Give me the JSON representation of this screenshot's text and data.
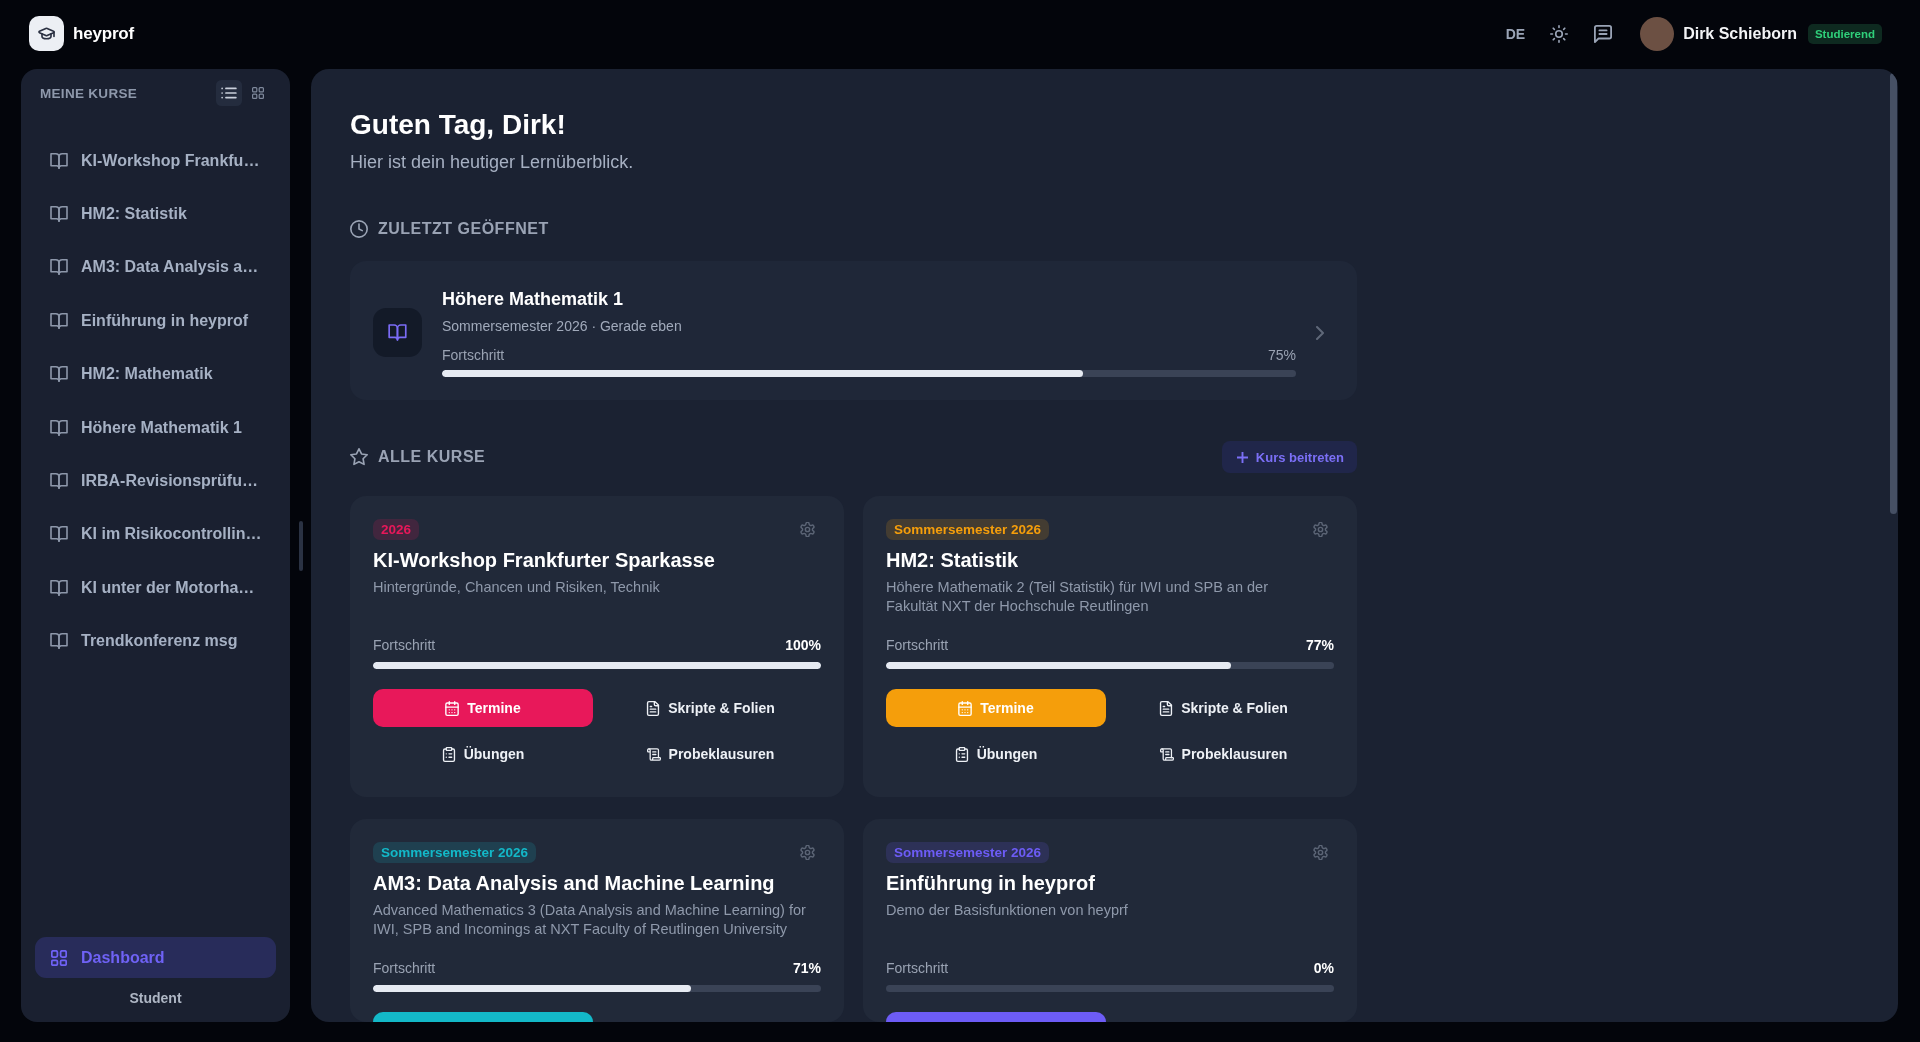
{
  "topbar": {
    "brand": "heyprof",
    "language": "DE",
    "user": {
      "name": "Dirk Schieborn",
      "role": "Studierend"
    }
  },
  "sidebar": {
    "title": "MEINE KURSE",
    "view_toggle": [
      {
        "kind": "list",
        "selected": true
      },
      {
        "kind": "grid",
        "selected": false
      }
    ],
    "items": [
      {
        "label": "KI-Workshop Frankfu…",
        "selected": false
      },
      {
        "label": "HM2: Statistik",
        "selected": false
      },
      {
        "label": "AM3: Data Analysis a…",
        "selected": false
      },
      {
        "label": "Einführung in heyprof",
        "selected": false
      },
      {
        "label": "HM2: Mathematik",
        "selected": false
      },
      {
        "label": "Höhere Mathematik 1",
        "selected": false
      },
      {
        "label": "IRBA-Revisionsprüfu…",
        "selected": false
      },
      {
        "label": "KI im Risikocontrollin…",
        "selected": false
      },
      {
        "label": "KI unter der Motorha…",
        "selected": false
      },
      {
        "label": "Trendkonferenz msg",
        "selected": false
      }
    ],
    "nav": [
      {
        "label": "Dashboard",
        "selected": true
      }
    ],
    "role_label": "Student"
  },
  "main": {
    "greeting": "Guten Tag, Dirk!",
    "subtitle": "Hier ist dein heutiger Lernüberblick.",
    "recent": {
      "heading": "ZULETZT GEÖFFNET",
      "course": {
        "title": "Höhere Mathematik 1",
        "meta": "Sommersemester 2026 · Gerade eben",
        "progress_label": "Fortschritt",
        "percent": "75%",
        "level": 0.75
      }
    },
    "all_courses": {
      "heading": "ALLE KURSE",
      "join_button": "Kurs beitreten",
      "courses": [
        {
          "tag": "2026",
          "color": "#e8185a",
          "title": "KI-Workshop Frankfurter Sparkasse",
          "description": "Hintergründe, Chancen und Risiken, Technik",
          "progress_label": "Fortschritt",
          "percent": "100%",
          "level": 1,
          "cut_off": false,
          "actions": [
            {
              "kind": "calendar",
              "label": "Termine",
              "primary": true
            },
            {
              "kind": "document",
              "label": "Skripte & Folien",
              "primary": false
            },
            {
              "kind": "clipboard",
              "label": "Übungen",
              "primary": false
            },
            {
              "kind": "scroll",
              "label": "Probeklausuren",
              "primary": false
            }
          ]
        },
        {
          "tag": "Sommersemester 2026",
          "color": "#f59e0b",
          "title": "HM2: Statistik",
          "description": "Höhere Mathematik 2 (Teil Statistik) für IWI und SPB an der Fakultät NXT der Hochschule Reutlingen",
          "progress_label": "Fortschritt",
          "percent": "77%",
          "level": 0.77,
          "cut_off": false,
          "actions": [
            {
              "kind": "calendar",
              "label": "Termine",
              "primary": true
            },
            {
              "kind": "document",
              "label": "Skripte & Folien",
              "primary": false
            },
            {
              "kind": "clipboard",
              "label": "Übungen",
              "primary": false
            },
            {
              "kind": "scroll",
              "label": "Probeklausuren",
              "primary": false
            }
          ]
        },
        {
          "tag": "Sommersemester 2026",
          "color": "#13b8c8",
          "title": "AM3: Data Analysis and Machine Learning",
          "description": "Advanced Mathematics 3 (Data Analysis and Machine Learning) for IWI, SPB and Incomings at NXT Faculty of Reutlingen University",
          "progress_label": "Fortschritt",
          "percent": "71%",
          "level": 0.71,
          "cut_off": true
        },
        {
          "tag": "Sommersemester 2026",
          "color": "#6d5cf6",
          "title": "Einführung in heyprof",
          "description": "Demo der Basisfunktionen von heyprf",
          "progress_label": "Fortschritt",
          "percent": "0%",
          "level": 0,
          "cut_off": true
        }
      ]
    }
  }
}
